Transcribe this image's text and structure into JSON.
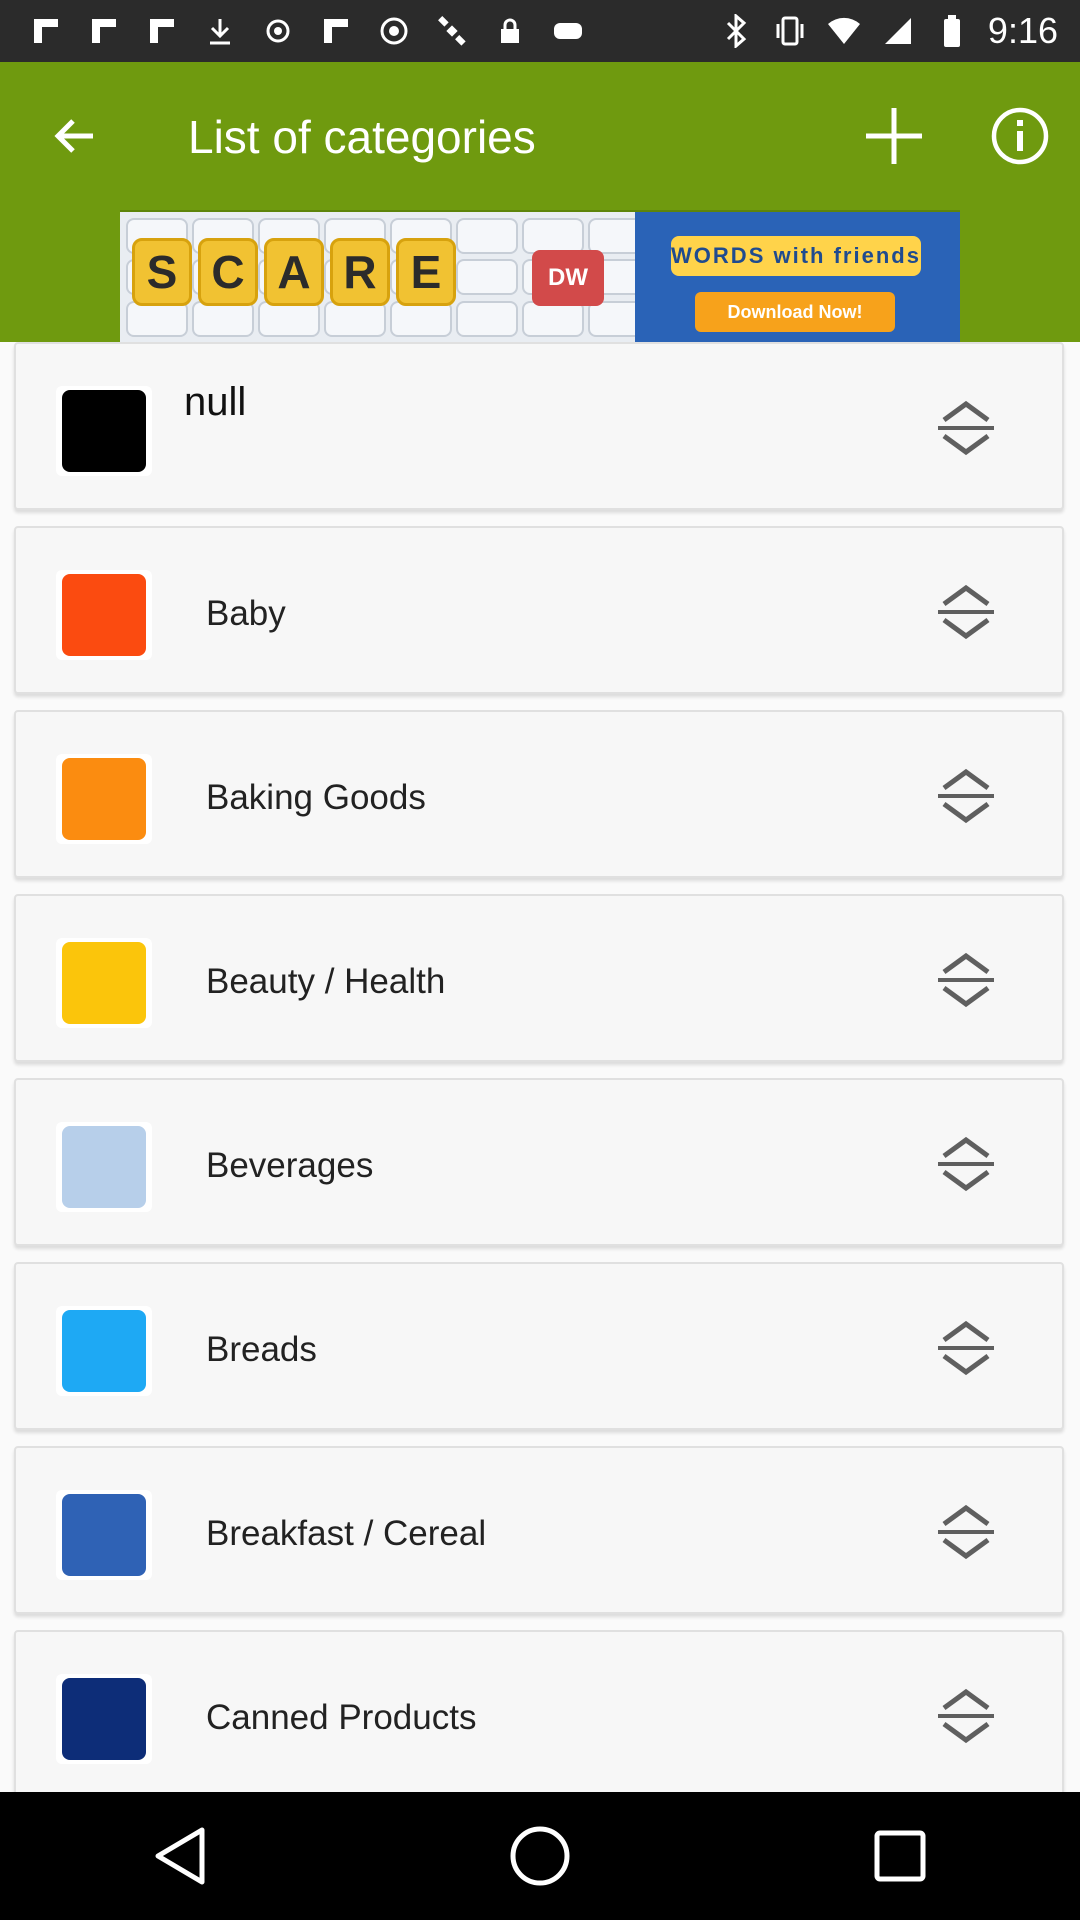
{
  "status_bar": {
    "time": "9:16",
    "left_icons": [
      "flipboard-icon",
      "flipboard-icon",
      "flipboard-icon",
      "download-icon",
      "record-icon",
      "flipboard-icon",
      "vpn-icon",
      "satellite-icon",
      "lock-icon",
      "game-controller-icon"
    ],
    "right_icons": [
      "bluetooth-icon",
      "vibrate-icon",
      "wifi-icon",
      "cell-signal-icon",
      "battery-icon"
    ]
  },
  "app_bar": {
    "title": "List of categories",
    "background": "#6f9a0f"
  },
  "ad": {
    "word": [
      "S",
      "C",
      "A",
      "R",
      "E"
    ],
    "dw_tile": "DW",
    "logo_text": "WORDS with friends",
    "cta": "Download Now!"
  },
  "categories": [
    {
      "name": "null",
      "color": "#000000"
    },
    {
      "name": "Baby",
      "color": "#fb4b10"
    },
    {
      "name": "Baking Goods",
      "color": "#fb8c10"
    },
    {
      "name": "Beauty / Health",
      "color": "#fbc50b"
    },
    {
      "name": "Beverages",
      "color": "#b7cfea"
    },
    {
      "name": "Breads",
      "color": "#1ea9f4"
    },
    {
      "name": "Breakfast / Cereal",
      "color": "#2f62b5"
    },
    {
      "name": "Canned Products",
      "color": "#0d2d78"
    }
  ]
}
